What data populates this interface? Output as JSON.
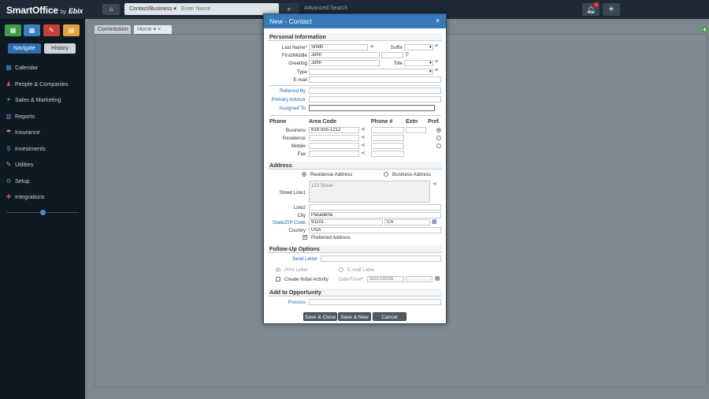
{
  "app": {
    "logo": "SmartOffice",
    "logo_by": "by",
    "logo_brand": "Ebix",
    "search_category": "Contact/Business ▾",
    "search_placeholder": "Enter Name",
    "advanced_search": "Advanced Search",
    "notification_count": "1"
  },
  "sidebar": {
    "tabs": [
      "Navigate",
      "History"
    ],
    "items": [
      {
        "label": "Calendar",
        "icon": "calendar-icon"
      },
      {
        "label": "People & Companies",
        "icon": "people-icon"
      },
      {
        "label": "Sales & Marketing",
        "icon": "sales-icon"
      },
      {
        "label": "Reports",
        "icon": "reports-icon"
      },
      {
        "label": "Insurance",
        "icon": "umbrella-icon"
      },
      {
        "label": "Investments",
        "icon": "dollar-icon"
      },
      {
        "label": "Utilities",
        "icon": "wrench-icon"
      },
      {
        "label": "Setup",
        "icon": "gears-icon"
      },
      {
        "label": "Integrations",
        "icon": "integrations-icon"
      }
    ]
  },
  "content": {
    "tabs": [
      "Commission",
      "Home ▾ ×"
    ]
  },
  "modal": {
    "title": "New - Contact",
    "close": "×",
    "personal": {
      "section": "Personal Information",
      "last_name_label": "Last Name",
      "last_name": "Smith",
      "suffix_label": "Suffix",
      "first_middle_label": "First/Middle",
      "first": "John",
      "greeting_label": "Greeting",
      "greeting": "John",
      "title_label": "Title",
      "type_label": "Type",
      "email_label": "E-mail",
      "referred_by_label": "Referred By",
      "primary_advisor_label": "Primary Advisor",
      "assigned_to_label": "Assigned To"
    },
    "phone": {
      "headers": [
        "Phone",
        "Area Code",
        "Phone #",
        "Extn",
        "Pref."
      ],
      "rows": [
        {
          "label": "Business",
          "value": "818-555-1212",
          "pref": true
        },
        {
          "label": "Residence",
          "value": "",
          "pref": false
        },
        {
          "label": "Mobile",
          "value": "",
          "pref": false
        },
        {
          "label": "Fax",
          "value": "",
          "pref": false
        }
      ]
    },
    "address": {
      "section": "Address",
      "residence_label": "Residence Address",
      "business_label": "Business Address",
      "street1_label": "Street Line1",
      "street1": "123  Street",
      "line2_label": "Line2",
      "city_label": "City",
      "city": "Pasadena",
      "state_zip_label": "State/ZIP Code",
      "zip": "91101",
      "state": "CA",
      "country_label": "Country",
      "country": "USA",
      "preferred_label": "Preferred Address"
    },
    "followup": {
      "section": "Follow-Up Options",
      "send_letter_label": "Send Letter",
      "print_letter": "Print Letter",
      "email_letter": "E-mail Letter",
      "create_activity": "Create Initial Activity",
      "datetime_label": "Date/Time",
      "date": "02/17/2016"
    },
    "opportunity": {
      "section": "Add to Opportunity",
      "process_label": "Process"
    },
    "buttons": {
      "save_close": "Save & Close",
      "save_new": "Save & New",
      "cancel": "Cancel"
    }
  },
  "colors": {
    "topbar": "#1d2935",
    "sidebar": "#0d1923",
    "modal_header": "#3579b9",
    "link_blue": "#1f67b5",
    "required_red": "#d01c1c"
  }
}
